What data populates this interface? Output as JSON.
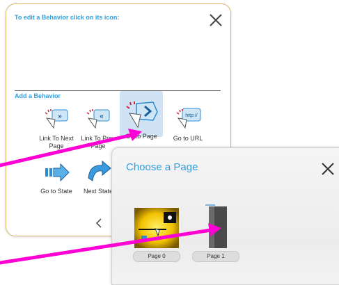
{
  "behavior_panel": {
    "title": "To edit a Behavior click on its icon:",
    "section_title": "Add a Behavior",
    "behaviors": [
      {
        "label": "Link To Next Page"
      },
      {
        "label": "Link To Prev Page"
      },
      {
        "label": "Go to Page"
      },
      {
        "label": "Go to URL"
      },
      {
        "label": "Go to State"
      },
      {
        "label": "Next State"
      }
    ],
    "url_icon_text": "http://"
  },
  "choose_page": {
    "title": "Choose a Page",
    "pages": [
      {
        "label": "Page 0"
      },
      {
        "label": "Page 1"
      }
    ]
  },
  "colors": {
    "accent": "#2e9fe0",
    "arrow": "#ff00d4"
  }
}
